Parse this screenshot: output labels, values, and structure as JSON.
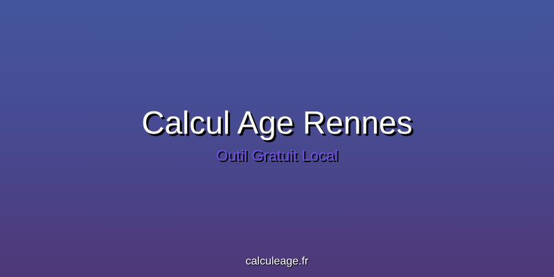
{
  "banner": {
    "title": "Calcul Age Rennes",
    "subtitle": "Outil Gratuit Local",
    "domain": "calculeage.fr"
  },
  "colors": {
    "gradient_top": "#43569d",
    "gradient_bottom": "#4e3878",
    "title": "#ffffff",
    "subtitle": "#6f4fe6",
    "shadow": "#000000"
  }
}
